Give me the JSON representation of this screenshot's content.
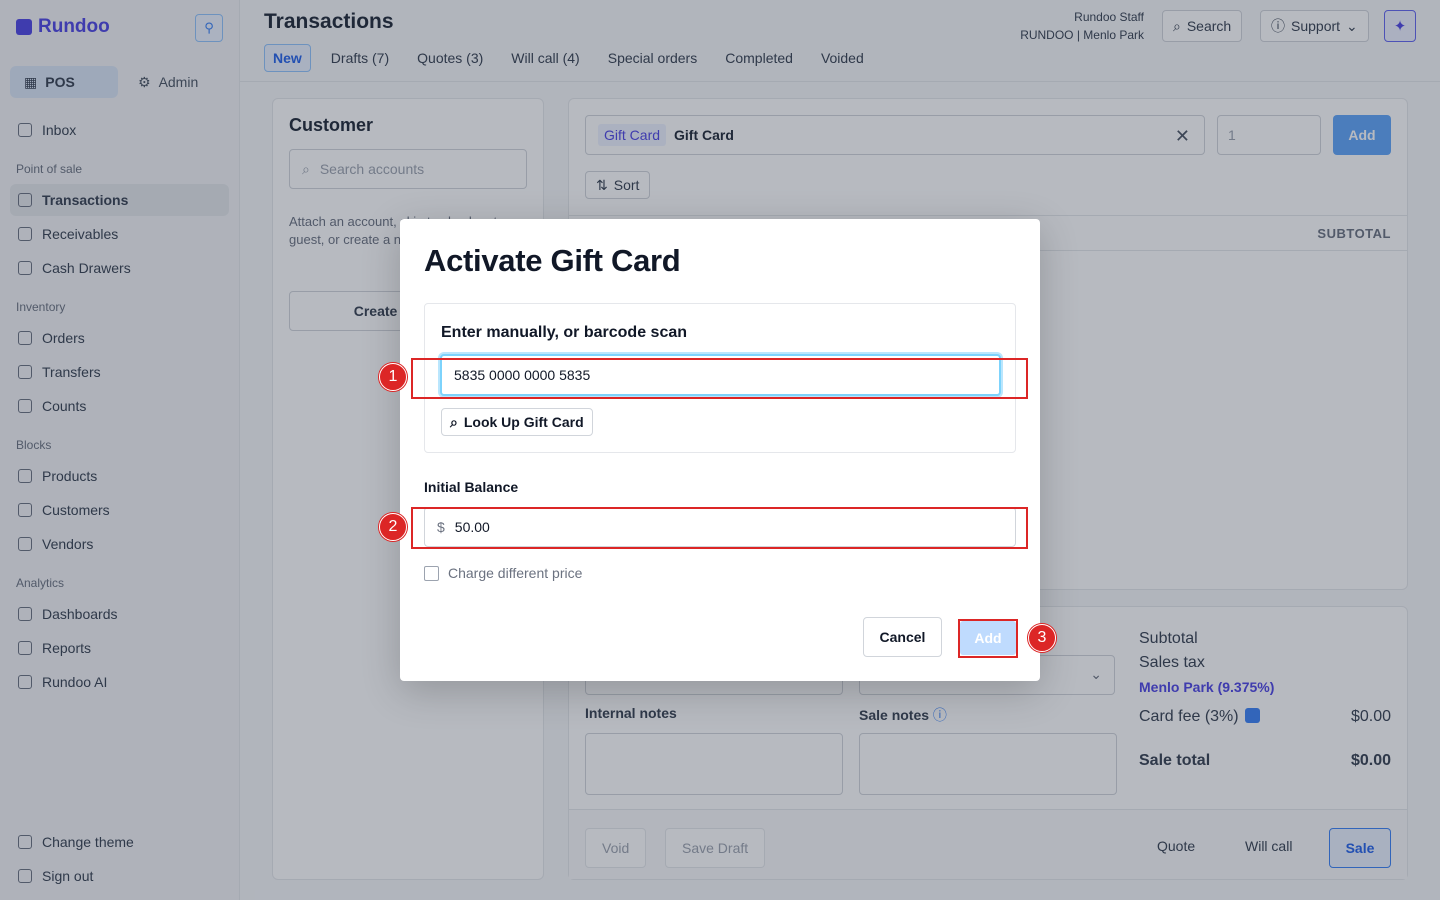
{
  "app": {
    "brand": "Rundoo"
  },
  "sidebar": {
    "modes": [
      {
        "label": "POS"
      },
      {
        "label": "Admin"
      }
    ],
    "inbox": "Inbox",
    "sections": [
      {
        "title": "Point of sale",
        "items": [
          "Transactions",
          "Receivables",
          "Cash Drawers"
        ]
      },
      {
        "title": "Inventory",
        "items": [
          "Orders",
          "Transfers",
          "Counts"
        ]
      },
      {
        "title": "Blocks",
        "items": [
          "Products",
          "Customers",
          "Vendors"
        ]
      },
      {
        "title": "Analytics",
        "items": [
          "Dashboards",
          "Reports",
          "Rundoo AI"
        ]
      }
    ],
    "bottom": [
      "Change theme",
      "Sign out"
    ]
  },
  "header": {
    "title": "Transactions",
    "tabs": [
      "New",
      "Drafts (7)",
      "Quotes (3)",
      "Will call (4)",
      "Special orders",
      "Completed",
      "Voided"
    ],
    "user_name": "Rundoo Staff",
    "user_location": "RUNDOO | Menlo Park",
    "search_label": "Search",
    "support_label": "Support"
  },
  "customer": {
    "title": "Customer",
    "search_placeholder": "Search accounts",
    "hint": "Attach an account, skip to check out a guest, or create a new account",
    "create_label": "Create customer"
  },
  "items": {
    "chip": "Gift Card",
    "product": "Gift Card",
    "qty_placeholder": "1",
    "add_label": "Add",
    "sort_label": "Sort",
    "subtotal_header": "SUBTOTAL"
  },
  "totals": {
    "internal_notes": "Internal notes",
    "sale_notes": "Sale notes",
    "subtotal_label": "Subtotal",
    "sales_tax_label": "Sales tax",
    "tax_location": "Menlo Park (9.375%)",
    "card_fee_label": "Card fee (3%)",
    "card_fee_value": "$0.00",
    "sale_total_label": "Sale total",
    "sale_total_value": "$0.00",
    "void_label": "Void",
    "save_draft_label": "Save Draft",
    "quote_label": "Quote",
    "will_call_label": "Will call",
    "sale_label": "Sale"
  },
  "modal": {
    "title": "Activate Gift Card",
    "scan_label": "Enter manually, or barcode scan",
    "card_number": "5835 0000 0000 5835",
    "lookup_label": "Look Up Gift Card",
    "balance_label": "Initial Balance",
    "currency": "$",
    "balance_value": "50.00",
    "charge_different_label": "Charge different price",
    "cancel_label": "Cancel",
    "add_label": "Add"
  },
  "annotations": [
    "1",
    "2",
    "3"
  ]
}
